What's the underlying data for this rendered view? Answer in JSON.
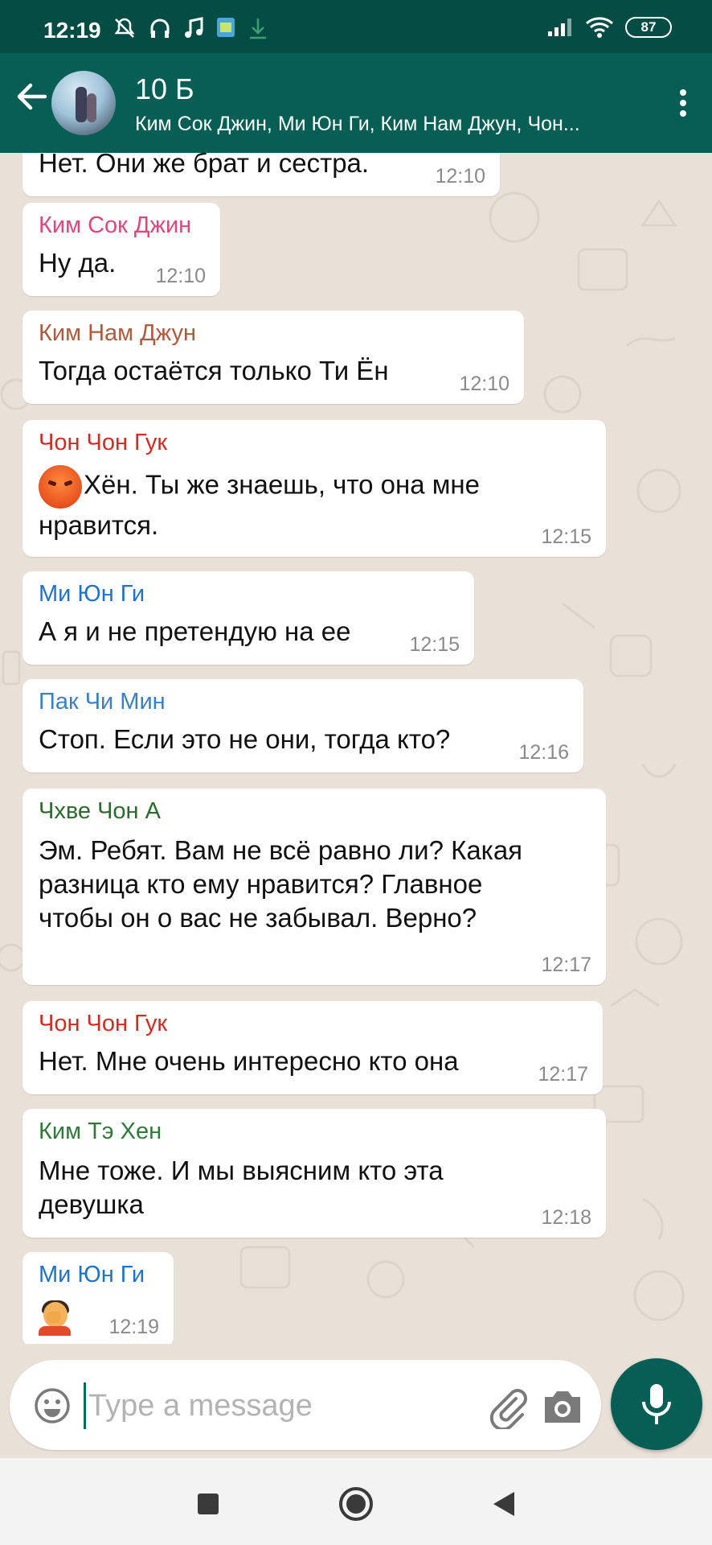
{
  "status_bar": {
    "time": "12:19",
    "battery": "87",
    "icons": [
      "mute-icon",
      "headphones-icon",
      "music-icon",
      "app-icon",
      "download-icon",
      "signal-icon",
      "wifi-icon",
      "battery-icon"
    ]
  },
  "header": {
    "title": "10 Б",
    "subtitle": "Ким Сок Джин, Ми Юн Ги, Ким Нам Джун, Чон..."
  },
  "colors": {
    "header": "#075e54",
    "status_bar": "#054d44",
    "chat_background": "#e9e1d8",
    "bubble": "#ffffff",
    "time": "#8a8a8a"
  },
  "messages": [
    {
      "sender": "",
      "text": "Нет. Они же брат и сестра.",
      "time": "12:10"
    },
    {
      "sender": "Ким Сок Джин",
      "sender_color": "#e0467c",
      "text": "Ну да.",
      "time": "12:10"
    },
    {
      "sender": "Ким Нам Джун",
      "sender_color": "#b05a3c",
      "text": "Тогда остаётся только Ти Ён",
      "time": "12:10"
    },
    {
      "sender": "Чон Чон Гук",
      "sender_color": "#d42a21",
      "text": "Хён. Ты же знаешь, что она мне нравится.",
      "emoji": "angry-face",
      "time": "12:15"
    },
    {
      "sender": "Ми Юн Ги",
      "sender_color": "#1f72c9",
      "text": "А я и не претендую на ее",
      "time": "12:15"
    },
    {
      "sender": "Пак Чи Мин",
      "sender_color": "#3a80c8",
      "text": "Стоп. Если это не они, тогда кто?",
      "time": "12:16"
    },
    {
      "sender": "Чхве Чон А",
      "sender_color": "#2d6a2d",
      "text": "Эм. Ребят. Вам не всё равно ли? Какая разница кто ему нравится? Главное чтобы он о вас не забывал. Верно?",
      "time": "12:17"
    },
    {
      "sender": "Чон Чон Гук",
      "sender_color": "#d42a21",
      "text": "Нет. Мне очень интересно кто она",
      "time": "12:17"
    },
    {
      "sender": "Ким Тэ Хен",
      "sender_color": "#2d7a3a",
      "text": "Мне тоже. И мы выясним кто эта девушка",
      "time": "12:18"
    },
    {
      "sender": "Ми Юн Ги",
      "sender_color": "#1f72c9",
      "text": "",
      "emoji": "facepalm",
      "time": "12:19"
    }
  ],
  "input": {
    "placeholder": "Type a message",
    "value": ""
  }
}
